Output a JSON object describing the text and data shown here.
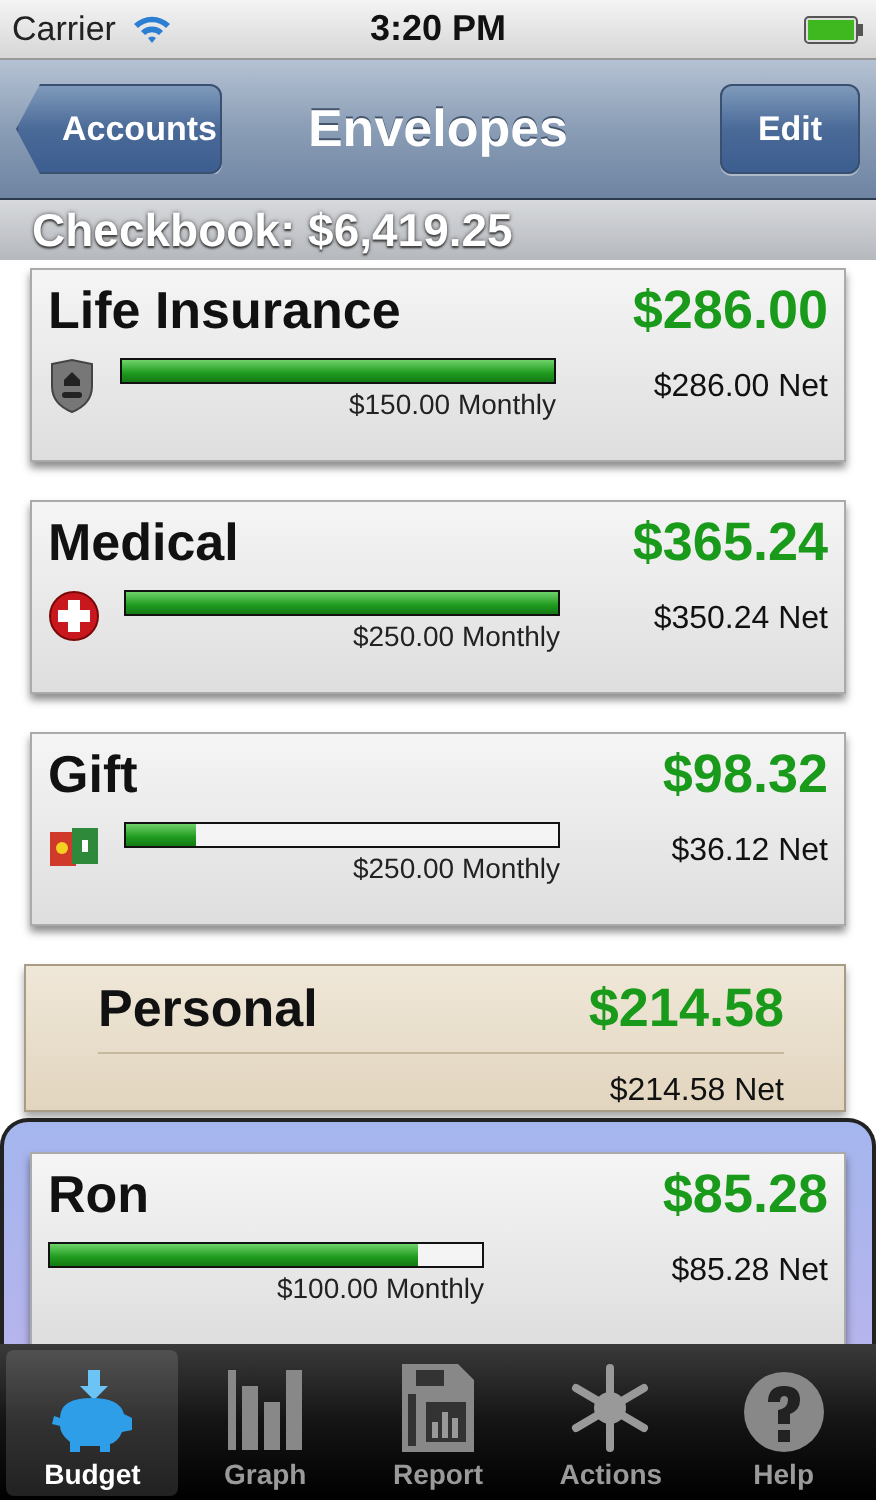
{
  "status_bar": {
    "carrier": "Carrier",
    "time": "3:20 PM"
  },
  "nav_bar": {
    "back_button": "Accounts",
    "title": "Envelopes",
    "edit_button": "Edit"
  },
  "account_header": "Checkbook: $6,419.25",
  "envelopes": [
    {
      "kind": "envelope",
      "name": "Life Insurance",
      "balance": "$286.00",
      "level": 1,
      "monthly": "$150.00 Monthly",
      "net": "$286.00 Net",
      "selected": false
    },
    {
      "kind": "envelope",
      "name": "Medical",
      "balance": "$365.24",
      "level": 1,
      "monthly": "$250.00 Monthly",
      "net": "$350.24 Net",
      "selected": false
    },
    {
      "kind": "envelope",
      "name": "Gift",
      "balance": "$98.32",
      "level": 0.16,
      "monthly": "$250.00 Monthly",
      "net": "$36.12 Net",
      "selected": false
    },
    {
      "kind": "folder",
      "name": "Personal",
      "balance": "$214.58",
      "net": "$214.58 Net",
      "selected": false
    },
    {
      "kind": "envelope",
      "name": "Ron",
      "balance": "$85.28",
      "level": 0.85,
      "monthly": "$100.00 Monthly",
      "net": "$85.28 Net",
      "selected": true
    }
  ],
  "tab_bar": [
    {
      "label": "Budget",
      "selected": true
    },
    {
      "label": "Graph",
      "selected": false
    },
    {
      "label": "Report",
      "selected": false
    },
    {
      "label": "Actions",
      "selected": false
    },
    {
      "label": "Help",
      "selected": false
    }
  ]
}
